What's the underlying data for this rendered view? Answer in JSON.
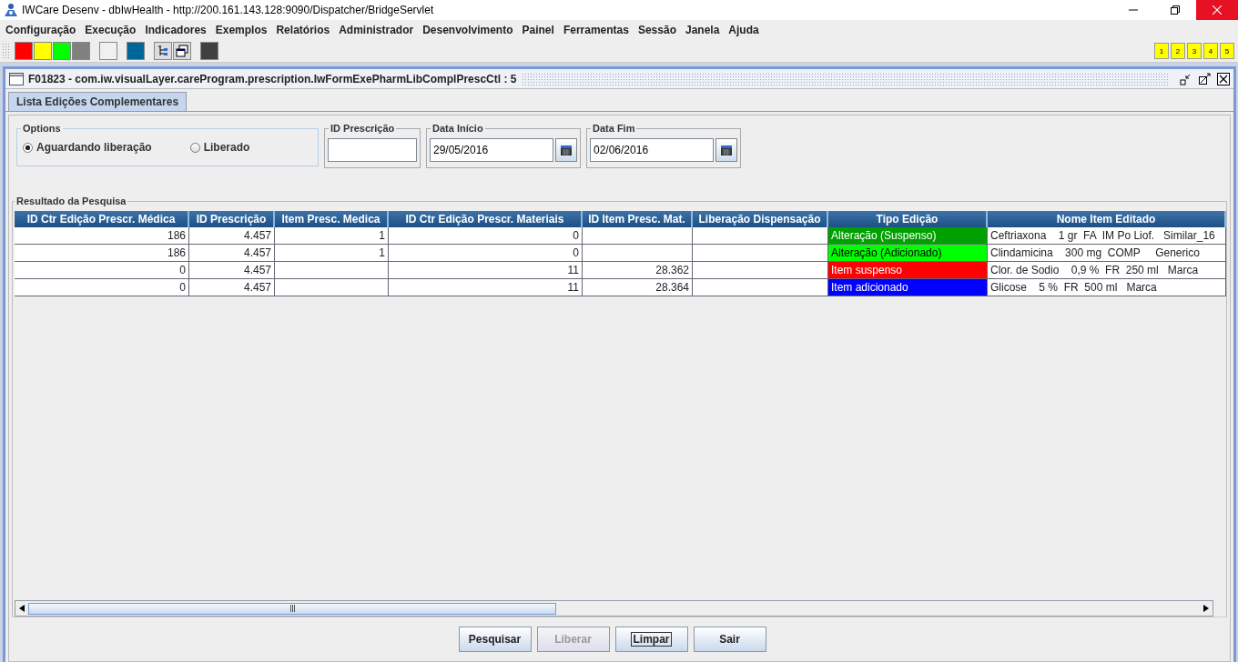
{
  "window": {
    "title": "IWCare Desenv - dbIwHealth - http://200.161.143.128:9090/Dispatcher/BridgeServlet"
  },
  "menu": [
    "Configuração",
    "Execução",
    "Indicadores",
    "Exemplos",
    "Relatórios",
    "Administrador",
    "Desenvolvimento",
    "Painel",
    "Ferramentas",
    "Sessão",
    "Janela",
    "Ajuda"
  ],
  "toolbar": [
    {
      "kind": "swatch",
      "color": "#ff0000"
    },
    {
      "kind": "swatch",
      "color": "#ffff00"
    },
    {
      "kind": "swatch",
      "color": "#00ff00"
    },
    {
      "kind": "swatch",
      "color": "#808080"
    },
    {
      "kind": "gap"
    },
    {
      "kind": "swatch",
      "color": "#f0f0f0"
    },
    {
      "kind": "gap"
    },
    {
      "kind": "swatch",
      "color": "#006699"
    },
    {
      "kind": "gap"
    },
    {
      "kind": "tree"
    },
    {
      "kind": "windows"
    },
    {
      "kind": "gap"
    },
    {
      "kind": "swatch",
      "color": "#404040"
    }
  ],
  "desktops": [
    "1",
    "2",
    "3",
    "4",
    "5"
  ],
  "frame": {
    "title": "F01823 - com.iw.visualLayer.careProgram.prescription.IwFormExePharmLibComplPrescCtl : 5"
  },
  "tabs": [
    {
      "label": "Lista Edições Complementares",
      "selected": true
    }
  ],
  "options": {
    "title": "Options",
    "items": [
      {
        "label": "Aguardando liberação",
        "selected": true
      },
      {
        "label": "Liberado",
        "selected": false
      }
    ]
  },
  "fields": [
    {
      "label": "ID Prescrição",
      "calendar": false
    },
    {
      "label": "Data Início",
      "value": "29/05/2016",
      "calendar": true
    },
    {
      "label": "Data Fim",
      "value": "02/06/2016",
      "calendar": true
    }
  ],
  "results": {
    "title": "Resultado da Pesquisa",
    "columns": [
      "ID Ctr Edição Prescr. Médica",
      "ID Prescrição",
      "Item Presc. Medica",
      "ID Ctr Edição Prescr. Materiais",
      "ID Item Presc. Mat.",
      "Liberação Dispensação",
      "Tipo Edição",
      "Nome Item Editado"
    ],
    "rows": [
      {
        "cells": [
          "186",
          "4.457",
          "1",
          "0",
          "",
          "",
          "Alteração (Suspenso)",
          "Ceftriaxona    1 gr  FA  IM Po Liof.   Similar_16"
        ],
        "color": "#00a000"
      },
      {
        "cells": [
          "186",
          "4.457",
          "1",
          "0",
          "",
          "",
          "Alteração (Adicionado)",
          "Clindamicina    300 mg  COMP     Generico"
        ],
        "color": "#00ff00"
      },
      {
        "cells": [
          "0",
          "4.457",
          "",
          "11",
          "28.362",
          "",
          "Item suspenso",
          "Clor. de Sodio    0,9 %  FR  250 ml   Marca"
        ],
        "color": "#ff0000"
      },
      {
        "cells": [
          "0",
          "4.457",
          "",
          "11",
          "28.364",
          "",
          "Item adicionado",
          "Glicose    5 %  FR  500 ml   Marca"
        ],
        "color": "#0000ff"
      }
    ]
  },
  "buttons": [
    {
      "label": "Pesquisar",
      "disabled": false,
      "focused": false
    },
    {
      "label": "Liberar",
      "disabled": true,
      "focused": false
    },
    {
      "label": "Limpar",
      "disabled": false,
      "focused": true
    },
    {
      "label": "Sair",
      "disabled": false,
      "focused": false
    }
  ]
}
